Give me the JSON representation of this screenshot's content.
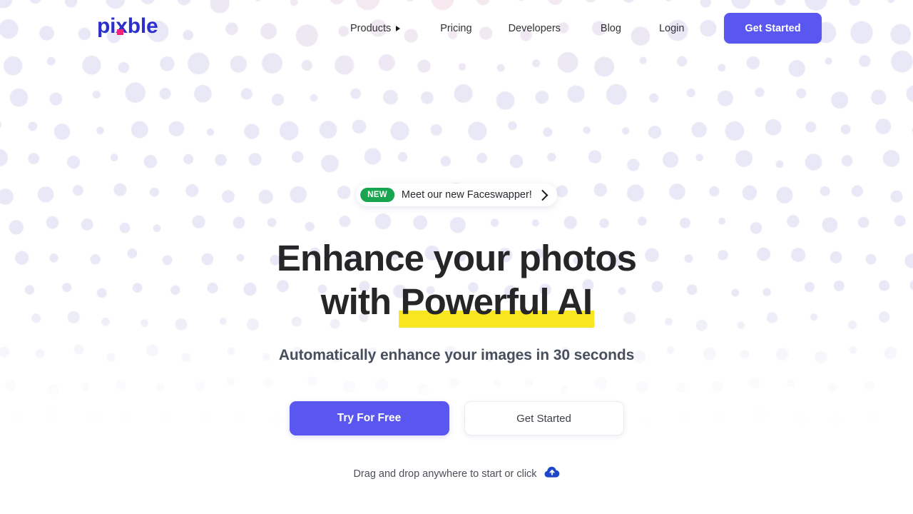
{
  "brand": {
    "logo_text_before": "pi",
    "logo_text_x": "x",
    "logo_text_after": "ble",
    "logo_full": "pixble",
    "logo_color": "#2B2FCB",
    "logo_accent_color": "#F0257A"
  },
  "nav": {
    "items": [
      {
        "label": "Products",
        "has_dropdown": true,
        "icon": "caret-right-icon"
      },
      {
        "label": "Pricing",
        "has_dropdown": false
      },
      {
        "label": "Developers",
        "has_dropdown": false
      },
      {
        "label": "Blog",
        "has_dropdown": false
      },
      {
        "label": "Login",
        "has_dropdown": false
      }
    ],
    "cta_label": "Get Started",
    "cta_color": "#5A56F0"
  },
  "announcement": {
    "badge": "NEW",
    "badge_color": "#19A450",
    "text": "Meet our new Faceswapper!",
    "arrow_icon": "chevron-right-icon"
  },
  "hero": {
    "headline_line1": "Enhance your photos",
    "headline_line2_prefix": "with ",
    "headline_line2_highlight": "Powerful AI",
    "highlight_color": "#F7E620",
    "subheadline": "Automatically enhance your images in 30 seconds",
    "primary_cta": "Try For Free",
    "secondary_cta": "Get Started",
    "drop_hint": "Drag and drop anywhere to start or click",
    "upload_icon": "cloud-upload-icon",
    "upload_icon_color": "#1E46C8"
  },
  "background": {
    "dot_color_lavender": "#E8E8F6",
    "dot_color_pink": "#F7E9EF",
    "page_color": "#FFFFFF"
  }
}
